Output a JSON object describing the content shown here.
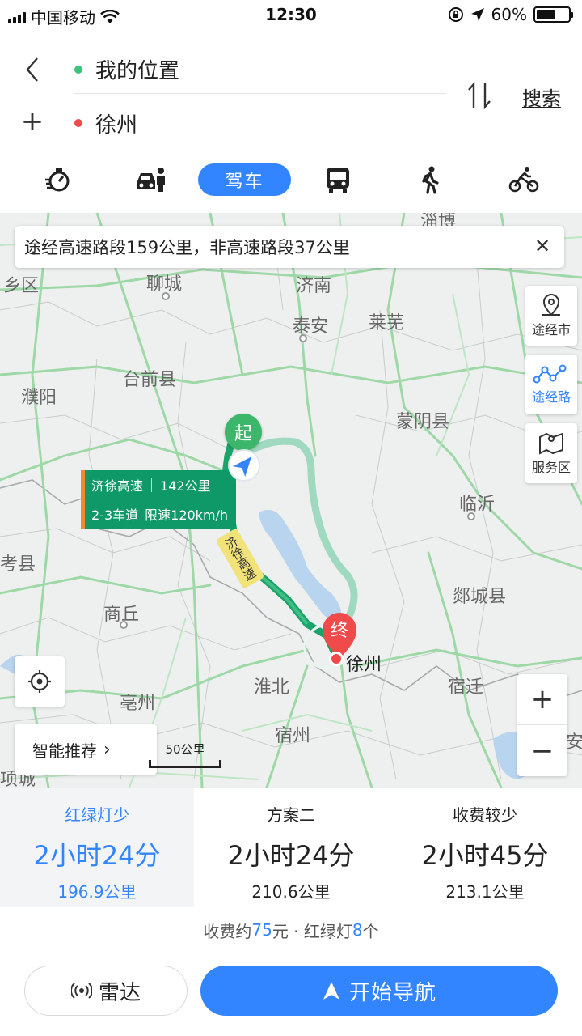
{
  "status_bar": {
    "carrier": "中国移动",
    "time": "12:30",
    "battery": "60%",
    "battery_level": 0.6
  },
  "route": {
    "from": "我的位置",
    "to": "徐州",
    "search_label": "搜索",
    "from_dot_color": "#3cc37c",
    "to_dot_color": "#f04a4a"
  },
  "modes": {
    "active_label": "驾车",
    "items": [
      "taxi-icon",
      "ride-hailing-icon",
      "car-icon",
      "bus-icon",
      "walk-icon",
      "bike-icon"
    ]
  },
  "map": {
    "banner": "途经高速路段159公里，非高速路段37公里",
    "side_panels": [
      {
        "label": "途经市",
        "icon": "location-pin-icon",
        "active": false
      },
      {
        "label": "途经路",
        "icon": "route-icon",
        "active": true
      },
      {
        "label": "服务区",
        "icon": "map-icon",
        "active": false
      }
    ],
    "cities": [
      "聊城",
      "济南",
      "泰安",
      "莱芜",
      "台前县",
      "濮阳",
      "蒙阴县",
      "临沂",
      "考县",
      "商丘",
      "郯城县",
      "淮北",
      "宿迁",
      "亳州",
      "宿州",
      "乡区",
      "项城",
      "淄博",
      "安"
    ],
    "road_card": {
      "name": "济徐高速",
      "distance": "142公里",
      "lanes": "2-3车道",
      "speed": "限速120km/h"
    },
    "road_tag": "济徐高速",
    "start_label": "起",
    "end_label": "终",
    "destination_label": "徐州",
    "smart_label": "智能推荐",
    "scale_label": "50公里",
    "route_color": "#1aa46a",
    "alt_route_color": "#9fd9c0"
  },
  "plans": [
    {
      "name": "红绿灯少",
      "time": "2小时24分",
      "distance": "196.9公里",
      "selected": true
    },
    {
      "name": "方案二",
      "time": "2小时24分",
      "distance": "210.6公里",
      "selected": false
    },
    {
      "name": "收费较少",
      "time": "2小时45分",
      "distance": "213.1公里",
      "selected": false
    }
  ],
  "summary": {
    "fee_prefix": "收费约",
    "fee_value": "75",
    "fee_suffix": "元 · 红绿灯",
    "lights_value": "8",
    "lights_suffix": "个"
  },
  "actions": {
    "radar": "雷达",
    "start_nav": "开始导航"
  },
  "colors": {
    "accent": "#3385ff"
  }
}
